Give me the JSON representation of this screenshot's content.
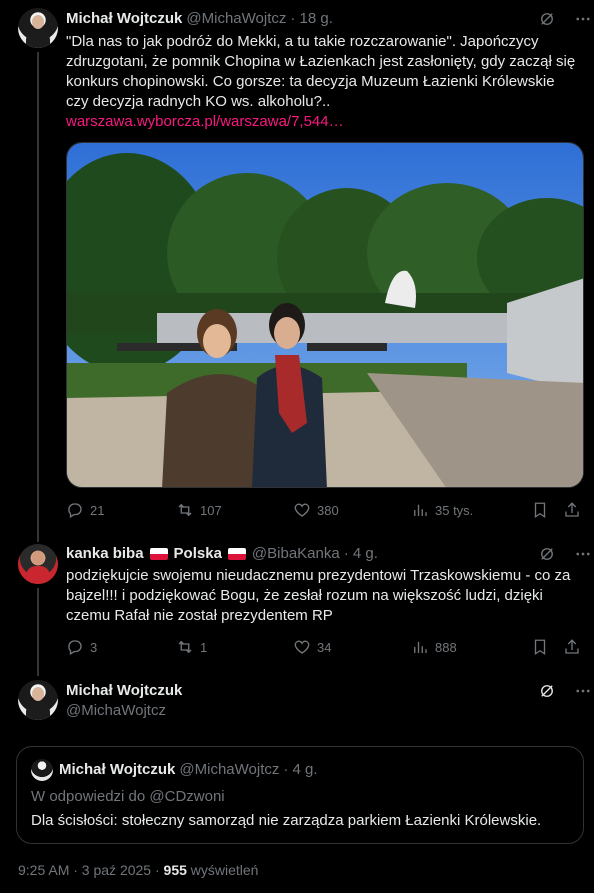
{
  "tweet1": {
    "name": "Michał Wojtczuk",
    "handle": "@MichaWojtcz",
    "time": "· 18 g.",
    "text": "\"Dla nas to jak podróż do Mekki, a tu takie rozczarowanie\". Japończycy zdruzgotani, że pomnik Chopina w Łazienkach jest zasłonięty, gdy zaczął się konkurs chopinowski. Co gorsze: ta decyzja Muzeum Łazienki Królewskie czy decyzja radnych KO ws. alkoholu?..",
    "link": "warszawa.wyborcza.pl/warszawa/7,544…",
    "replies": "21",
    "reposts": "107",
    "likes": "380",
    "views": "35 tys."
  },
  "tweet2": {
    "name": "kanka biba",
    "flag_label": "Polska",
    "handle": "@BibaKanka",
    "time": "· 4 g.",
    "text": "podziękujcie swojemu nieudacznemu prezydentowi Trzaskowskiemu - co za bajzel!!! i podziękować Bogu, że zesłał rozum na większość ludzi, dzięki czemu Rafał nie został prezydentem RP",
    "replies": "3",
    "reposts": "1",
    "likes": "34",
    "views": "888"
  },
  "tweet3": {
    "name": "Michał Wojtczuk",
    "handle": "@MichaWojtcz"
  },
  "quote": {
    "name": "Michał Wojtczuk",
    "handle": "@MichaWojtcz",
    "time": "· 4 g.",
    "reply_to": "W odpowiedzi do @CDzwoni",
    "text": "Dla ścisłości: stołeczny samorząd nie zarządza parkiem Łazienki Królewskie."
  },
  "footer": {
    "time": "9:25 AM · 3 paź 2025 ·",
    "views": "955",
    "views_label": "wyświetleń"
  },
  "icons": {
    "grok": "grok-icon",
    "more": "more-dots-icon",
    "reply": "reply-icon",
    "repost": "repost-icon",
    "like": "heart-icon",
    "views": "views-chart-icon",
    "bookmark": "bookmark-icon",
    "share": "share-icon"
  }
}
